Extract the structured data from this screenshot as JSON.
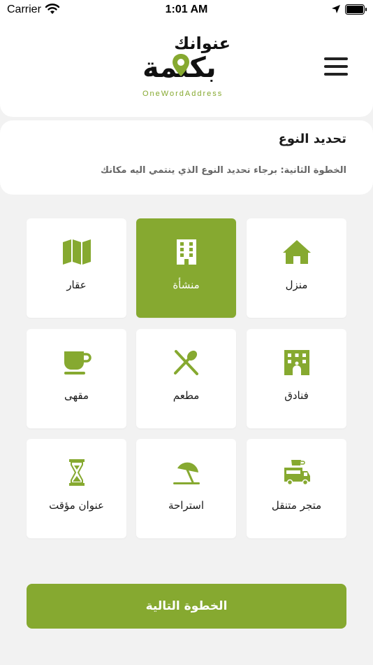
{
  "status_bar": {
    "carrier": "Carrier",
    "time": "1:01 AM",
    "icons": [
      "wifi-icon",
      "location-arrow-icon",
      "battery-icon"
    ]
  },
  "header": {
    "logo": {
      "line1": "عنوانك",
      "line2": "بكلمة",
      "tagline": "OneWordAddress"
    },
    "menu_icon": "hamburger-menu-icon"
  },
  "step": {
    "title": "تحديد النوع",
    "description": "الخطوة الثانية: برجاء تحديد النوع الذي ينتمي اليه مكانك"
  },
  "types": [
    {
      "label": "منزل",
      "icon": "house-icon",
      "selected": false
    },
    {
      "label": "منشأة",
      "icon": "building-icon",
      "selected": true
    },
    {
      "label": "عقار",
      "icon": "map-icon",
      "selected": false
    },
    {
      "label": "فنادق",
      "icon": "hotel-icon",
      "selected": false
    },
    {
      "label": "مطعم",
      "icon": "utensils-icon",
      "selected": false
    },
    {
      "label": "مقهى",
      "icon": "coffee-cup-icon",
      "selected": false
    },
    {
      "label": "متجر متنقل",
      "icon": "food-truck-icon",
      "selected": false
    },
    {
      "label": "استراحة",
      "icon": "beach-umbrella-icon",
      "selected": false
    },
    {
      "label": "عنوان مؤقت",
      "icon": "hourglass-icon",
      "selected": false
    }
  ],
  "next_button": {
    "label": "الخطوة التالية"
  },
  "colors": {
    "accent": "#86a930",
    "background": "#f2f2f2",
    "card": "#ffffff"
  }
}
